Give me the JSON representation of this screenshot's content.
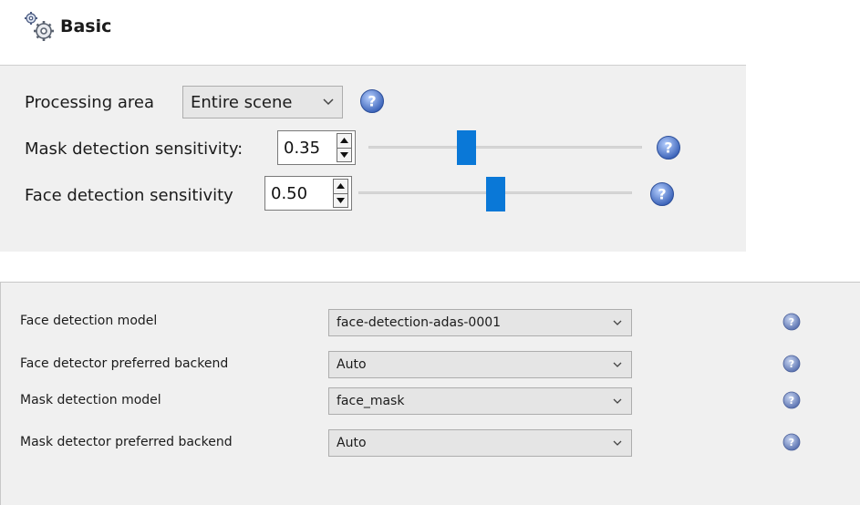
{
  "header": {
    "title": "Basic",
    "icon": "gears-icon"
  },
  "basic": {
    "processing_area": {
      "label": "Processing area",
      "value": "Entire scene"
    },
    "mask_sensitivity": {
      "label": "Mask detection sensitivity:",
      "value": "0.35",
      "level": 0.35
    },
    "face_sensitivity": {
      "label": "Face detection sensitivity",
      "value": "0.50",
      "level": 0.5
    }
  },
  "advanced": {
    "rows": [
      {
        "label": "Face detection model",
        "value": "face-detection-adas-0001"
      },
      {
        "label": "Face detector preferred backend",
        "value": "Auto"
      },
      {
        "label": "Mask detection model",
        "value": "face_mask"
      },
      {
        "label": "Mask detector preferred backend",
        "value": "Auto"
      }
    ]
  },
  "colors": {
    "accent": "#0a78d7",
    "help_blue": "#3a62b8",
    "panel_bg": "#f0f0f0"
  }
}
